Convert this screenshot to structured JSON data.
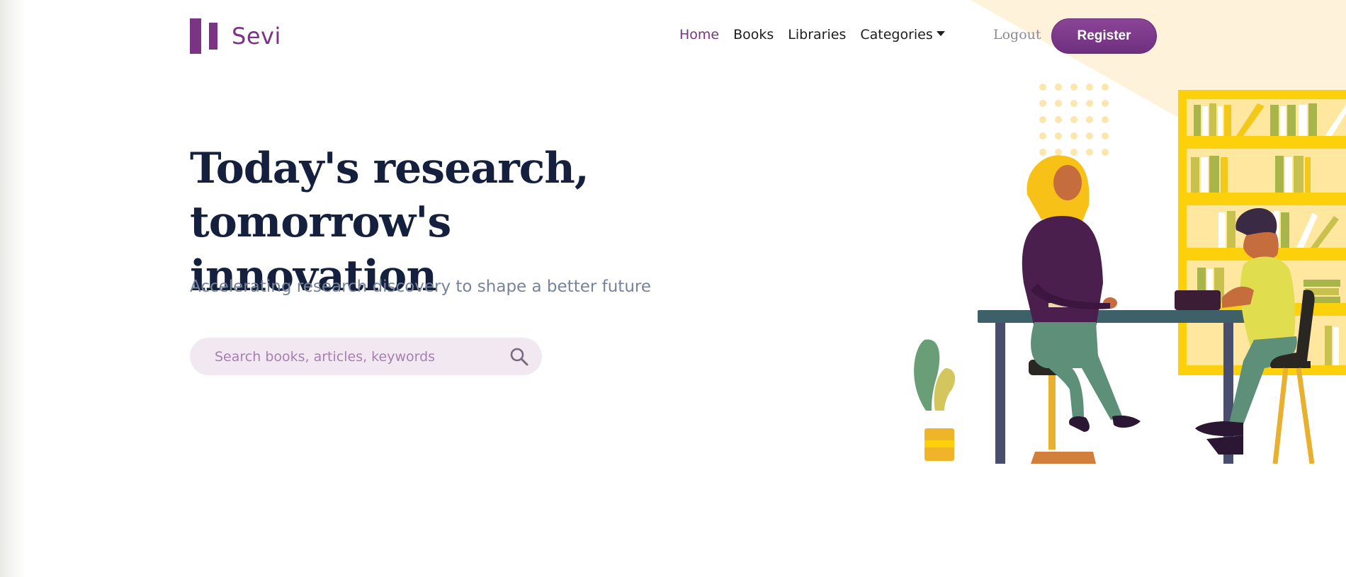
{
  "brand": {
    "name": "Sevi"
  },
  "nav": {
    "items": [
      {
        "label": "Home"
      },
      {
        "label": "Books"
      },
      {
        "label": "Libraries"
      },
      {
        "label": "Categories"
      }
    ],
    "logout_label": "Logout",
    "register_label": "Register"
  },
  "hero": {
    "title_line1": "Today's research,",
    "title_line2": "tomorrow's innovation",
    "subtitle": "Accelerating research discovery to shape a better future"
  },
  "search": {
    "placeholder": "Search books, articles, keywords",
    "value": ""
  },
  "colors": {
    "brand_purple": "#7b3384",
    "heading": "#14203d",
    "subtitle": "#76839a",
    "search_bg": "#f1e8f2",
    "accent_yellow": "#ffcc00"
  },
  "icons": [
    "search-icon",
    "caret-down-icon"
  ]
}
